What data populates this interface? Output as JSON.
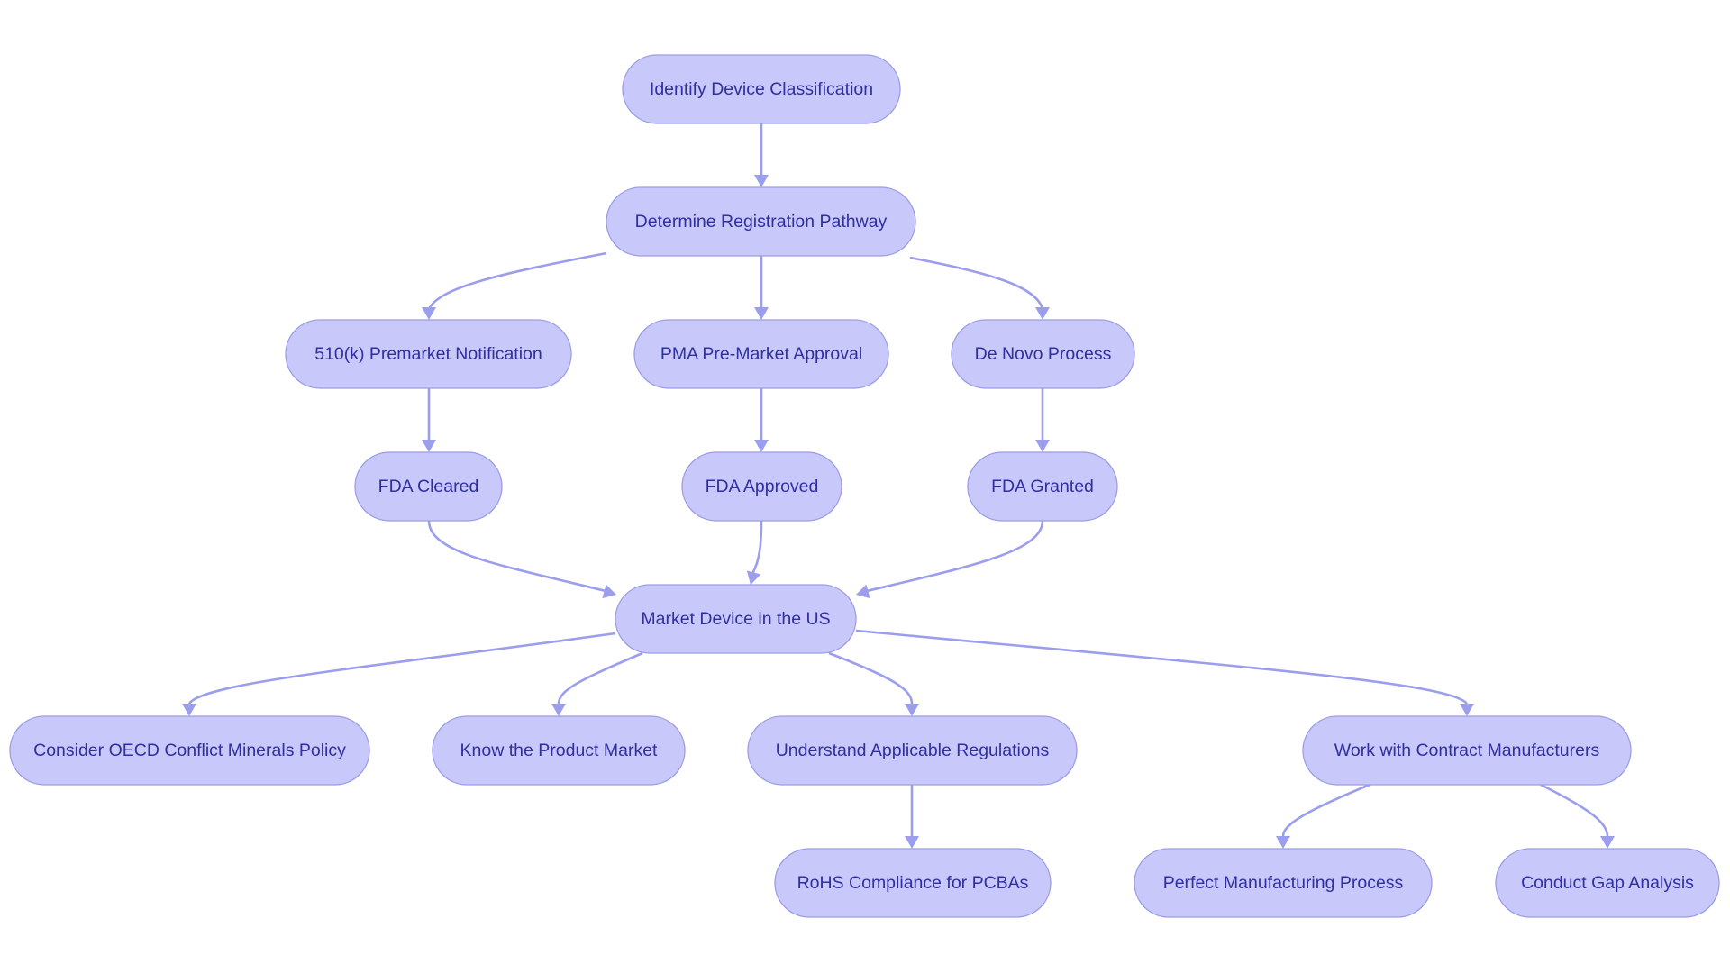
{
  "diagram": {
    "type": "flowchart",
    "direction": "top-down",
    "colors": {
      "node_fill": "#c8c8fa",
      "node_stroke": "#9c9ce6",
      "node_text": "#2f2fa2",
      "edge": "#9a9eec",
      "background": "#ffffff"
    },
    "nodes": [
      {
        "id": "identify",
        "label": "Identify Device Classification"
      },
      {
        "id": "determine",
        "label": "Determine Registration Pathway"
      },
      {
        "id": "k510",
        "label": "510(k) Premarket Notification"
      },
      {
        "id": "pma",
        "label": "PMA Pre-Market Approval"
      },
      {
        "id": "denovo",
        "label": "De Novo Process"
      },
      {
        "id": "cleared",
        "label": "FDA Cleared"
      },
      {
        "id": "approved",
        "label": "FDA Approved"
      },
      {
        "id": "granted",
        "label": "FDA Granted"
      },
      {
        "id": "market",
        "label": "Market Device in the US"
      },
      {
        "id": "oecd",
        "label": "Consider OECD Conflict Minerals Policy"
      },
      {
        "id": "know",
        "label": "Know the Product Market"
      },
      {
        "id": "understand",
        "label": "Understand Applicable Regulations"
      },
      {
        "id": "work",
        "label": "Work with Contract Manufacturers"
      },
      {
        "id": "rohs",
        "label": "RoHS Compliance for PCBAs"
      },
      {
        "id": "perfect",
        "label": "Perfect Manufacturing Process"
      },
      {
        "id": "gap",
        "label": "Conduct Gap Analysis"
      }
    ],
    "edges": [
      {
        "from": "identify",
        "to": "determine"
      },
      {
        "from": "determine",
        "to": "k510"
      },
      {
        "from": "determine",
        "to": "pma"
      },
      {
        "from": "determine",
        "to": "denovo"
      },
      {
        "from": "k510",
        "to": "cleared"
      },
      {
        "from": "pma",
        "to": "approved"
      },
      {
        "from": "denovo",
        "to": "granted"
      },
      {
        "from": "cleared",
        "to": "market"
      },
      {
        "from": "approved",
        "to": "market"
      },
      {
        "from": "granted",
        "to": "market"
      },
      {
        "from": "market",
        "to": "oecd"
      },
      {
        "from": "market",
        "to": "know"
      },
      {
        "from": "market",
        "to": "understand"
      },
      {
        "from": "market",
        "to": "work"
      },
      {
        "from": "understand",
        "to": "rohs"
      },
      {
        "from": "work",
        "to": "perfect"
      },
      {
        "from": "work",
        "to": "gap"
      }
    ]
  }
}
